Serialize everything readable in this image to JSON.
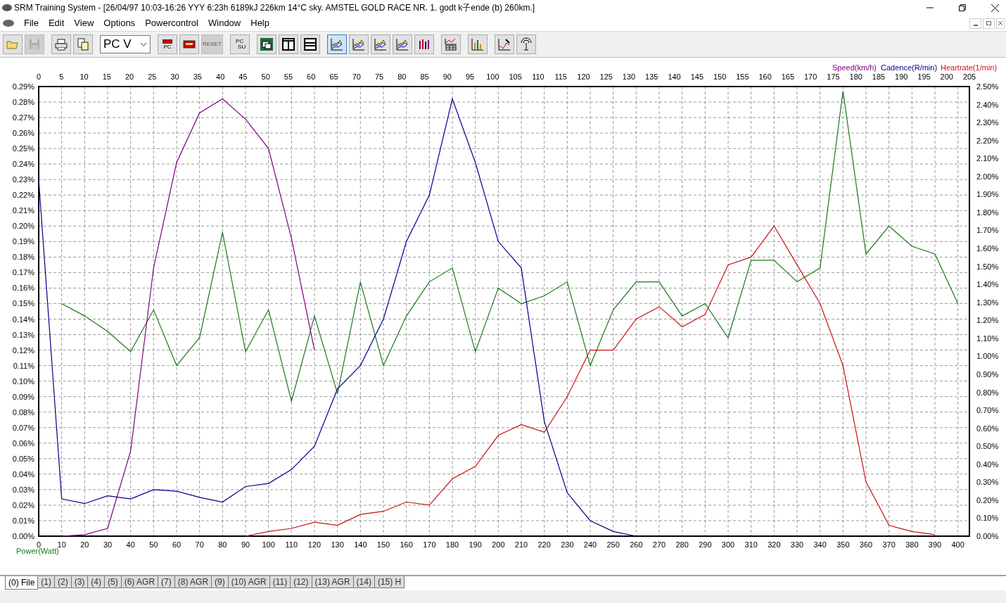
{
  "window": {
    "title": "SRM Training System - [26/04/97 10:03-16:26 YYY 6:23h 6189kJ 226km 14°C sky. AMSTEL GOLD RACE NR. 1. godt k子ende (b) 260km.]"
  },
  "menu": [
    "File",
    "Edit",
    "View",
    "Options",
    "Powercontrol",
    "Window",
    "Help"
  ],
  "toolbar": [
    {
      "buttons": [
        {
          "kind": "open",
          "disabled": false
        },
        {
          "kind": "save",
          "disabled": true
        }
      ]
    },
    {
      "buttons": [
        {
          "kind": "print",
          "disabled": false
        },
        {
          "kind": "copy",
          "disabled": false
        }
      ]
    },
    {
      "buttons": [
        {
          "kind": "combo",
          "value": "PC V",
          "disabled": false
        }
      ]
    },
    {
      "buttons": [
        {
          "kind": "pc-download",
          "label": "PC",
          "disabled": false
        },
        {
          "kind": "card",
          "disabled": false
        },
        {
          "kind": "reset",
          "label": "RESET",
          "disabled": true
        }
      ]
    },
    {
      "buttons": [
        {
          "kind": "pc-sv",
          "label": "PC",
          "sublabel": "SU",
          "disabled": false
        }
      ]
    },
    {
      "buttons": [
        {
          "kind": "cascade",
          "disabled": false
        },
        {
          "kind": "split-vertical",
          "disabled": false
        },
        {
          "kind": "split-horizontal",
          "disabled": false
        }
      ]
    },
    {
      "buttons": [
        {
          "kind": "chart-lines",
          "selected": true
        },
        {
          "kind": "chart-bands",
          "selected": false
        },
        {
          "kind": "chart-rise",
          "selected": false
        },
        {
          "kind": "chart-peaks",
          "selected": false
        },
        {
          "kind": "chart-bars",
          "selected": false
        }
      ]
    },
    {
      "buttons": [
        {
          "kind": "chart-table",
          "disabled": false
        }
      ]
    },
    {
      "buttons": [
        {
          "kind": "histogram",
          "disabled": false
        }
      ]
    },
    {
      "buttons": [
        {
          "kind": "chart-pen",
          "disabled": false
        },
        {
          "kind": "antenna",
          "disabled": false
        }
      ]
    }
  ],
  "chart": {
    "top_axis_labels": [
      "0",
      "5",
      "10",
      "15",
      "20",
      "25",
      "30",
      "35",
      "40",
      "45",
      "50",
      "55",
      "60",
      "65",
      "70",
      "75",
      "80",
      "85",
      "90",
      "95",
      "100",
      "105",
      "110",
      "115",
      "120",
      "125",
      "130",
      "135",
      "140",
      "145",
      "150",
      "155",
      "160",
      "165",
      "170",
      "175",
      "180",
      "185",
      "190",
      "195",
      "200",
      "205"
    ],
    "right_axis_labels": [
      "2.50%",
      "2.40%",
      "2.30%",
      "2.20%",
      "2.10%",
      "2.00%",
      "1.90%",
      "1.80%",
      "1.70%",
      "1.60%",
      "1.50%",
      "1.40%",
      "1.30%",
      "1.20%",
      "1.10%",
      "1.00%",
      "0.90%",
      "0.80%",
      "0.70%",
      "0.60%",
      "0.50%",
      "0.40%",
      "0.30%",
      "0.20%",
      "0.10%",
      "0.00%"
    ],
    "chart_data": {
      "type": "line",
      "grid": true,
      "xlim": [
        0,
        405
      ],
      "ylim": [
        0,
        0.29
      ],
      "x": [
        0,
        10,
        20,
        30,
        40,
        50,
        60,
        70,
        80,
        90,
        100,
        110,
        120,
        130,
        140,
        150,
        160,
        170,
        180,
        190,
        200,
        210,
        220,
        230,
        240,
        250,
        260,
        270,
        280,
        290,
        300,
        310,
        320,
        330,
        340,
        350,
        360,
        370,
        380,
        390,
        400
      ],
      "series": [
        {
          "name": "Power(Watt)",
          "color": "#1a7a1a",
          "values": [
            null,
            0.15,
            0.142,
            0.132,
            0.119,
            0.146,
            0.11,
            0.128,
            0.196,
            0.119,
            0.146,
            0.087,
            0.142,
            0.092,
            0.164,
            0.11,
            0.142,
            0.164,
            0.173,
            0.119,
            0.16,
            0.15,
            0.155,
            0.164,
            0.11,
            0.146,
            0.164,
            0.164,
            0.142,
            0.15,
            0.128,
            0.178,
            0.178,
            0.164,
            0.173,
            0.287,
            0.182,
            0.2,
            0.187,
            0.182,
            0.15
          ]
        },
        {
          "name": "Speed(km/h)",
          "color": "#800080",
          "values": [
            null,
            0,
            0.001,
            0.005,
            0.055,
            0.173,
            0.241,
            0.273,
            0.282,
            0.269,
            0.25,
            0.192,
            0.12,
            null,
            null,
            null,
            null,
            null,
            null,
            null,
            null,
            null,
            null,
            null,
            null,
            null,
            null,
            null,
            null,
            null,
            null,
            null,
            null,
            null,
            null,
            null,
            null,
            null,
            null,
            null,
            null
          ]
        },
        {
          "name": "Cadence(R/min)",
          "color": "#00008b",
          "values": [
            0.23,
            0.024,
            0.021,
            0.026,
            0.024,
            0.03,
            0.029,
            0.025,
            0.022,
            0.032,
            0.034,
            0.043,
            0.058,
            0.095,
            0.11,
            0.14,
            0.19,
            0.22,
            0.282,
            0.241,
            0.19,
            0.173,
            0.074,
            0.028,
            0.01,
            0.003,
            0,
            null,
            null,
            null,
            null,
            null,
            null,
            null,
            null,
            null,
            null,
            null,
            null,
            null,
            null
          ]
        },
        {
          "name": "Heartrate(1/min)",
          "color": "#cc1010",
          "values": [
            null,
            null,
            null,
            null,
            null,
            null,
            null,
            null,
            null,
            0,
            0.003,
            0.005,
            0.009,
            0.007,
            0.014,
            0.016,
            0.022,
            0.02,
            0.037,
            0.045,
            0.065,
            0.072,
            0.067,
            0.09,
            0.12,
            0.12,
            0.14,
            0.148,
            0.135,
            0.143,
            0.175,
            0.18,
            0.2,
            0.175,
            0.15,
            0.11,
            0.035,
            0.007,
            0.003,
            0.001,
            null
          ]
        }
      ],
      "xticks": [
        0,
        10,
        20,
        30,
        40,
        50,
        60,
        70,
        80,
        90,
        100,
        110,
        120,
        130,
        140,
        150,
        160,
        170,
        180,
        190,
        200,
        210,
        220,
        230,
        240,
        250,
        260,
        270,
        280,
        290,
        300,
        310,
        320,
        330,
        340,
        350,
        360,
        370,
        380,
        390,
        400
      ],
      "yticks": [
        {
          "value": 0,
          "label": "0.00%"
        },
        {
          "value": 0.01,
          "label": "0.01%"
        },
        {
          "value": 0.02,
          "label": "0.02%"
        },
        {
          "value": 0.03,
          "label": "0.03%"
        },
        {
          "value": 0.04,
          "label": "0.04%"
        },
        {
          "value": 0.05,
          "label": "0.05%"
        },
        {
          "value": 0.06,
          "label": "0.06%"
        },
        {
          "value": 0.07,
          "label": "0.07%"
        },
        {
          "value": 0.08,
          "label": "0.08%"
        },
        {
          "value": 0.09,
          "label": "0.09%"
        },
        {
          "value": 0.1,
          "label": "0.10%"
        },
        {
          "value": 0.11,
          "label": "0.11%"
        },
        {
          "value": 0.12,
          "label": "0.12%"
        },
        {
          "value": 0.13,
          "label": "0.13%"
        },
        {
          "value": 0.14,
          "label": "0.14%"
        },
        {
          "value": 0.15,
          "label": "0.15%"
        },
        {
          "value": 0.16,
          "label": "0.16%"
        },
        {
          "value": 0.17,
          "label": "0.17%"
        },
        {
          "value": 0.18,
          "label": "0.18%"
        },
        {
          "value": 0.19,
          "label": "0.19%"
        },
        {
          "value": 0.2,
          "label": "0.20%"
        },
        {
          "value": 0.21,
          "label": "0.21%"
        },
        {
          "value": 0.22,
          "label": "0.22%"
        },
        {
          "value": 0.23,
          "label": "0.23%"
        },
        {
          "value": 0.24,
          "label": "0.24%"
        },
        {
          "value": 0.25,
          "label": "0.25%"
        },
        {
          "value": 0.26,
          "label": "0.26%"
        },
        {
          "value": 0.27,
          "label": "0.27%"
        },
        {
          "value": 0.28,
          "label": "0.28%"
        },
        {
          "value": 0.29,
          "label": "0.29%"
        }
      ]
    }
  },
  "tabs": [
    {
      "label": "(0) File",
      "selected": true
    },
    {
      "label": "(1)",
      "selected": false
    },
    {
      "label": "(2)",
      "selected": false
    },
    {
      "label": "(3)",
      "selected": false
    },
    {
      "label": "(4)",
      "selected": false
    },
    {
      "label": "(5)",
      "selected": false
    },
    {
      "label": "(6) AGR",
      "selected": false
    },
    {
      "label": "(7)",
      "selected": false
    },
    {
      "label": "(8) AGR",
      "selected": false
    },
    {
      "label": "(9)",
      "selected": false
    },
    {
      "label": "(10) AGR",
      "selected": false
    },
    {
      "label": "(11)",
      "selected": false
    },
    {
      "label": "(12)",
      "selected": false
    },
    {
      "label": "(13) AGR",
      "selected": false
    },
    {
      "label": "(14)",
      "selected": false
    },
    {
      "label": "(15) H",
      "selected": false
    }
  ]
}
